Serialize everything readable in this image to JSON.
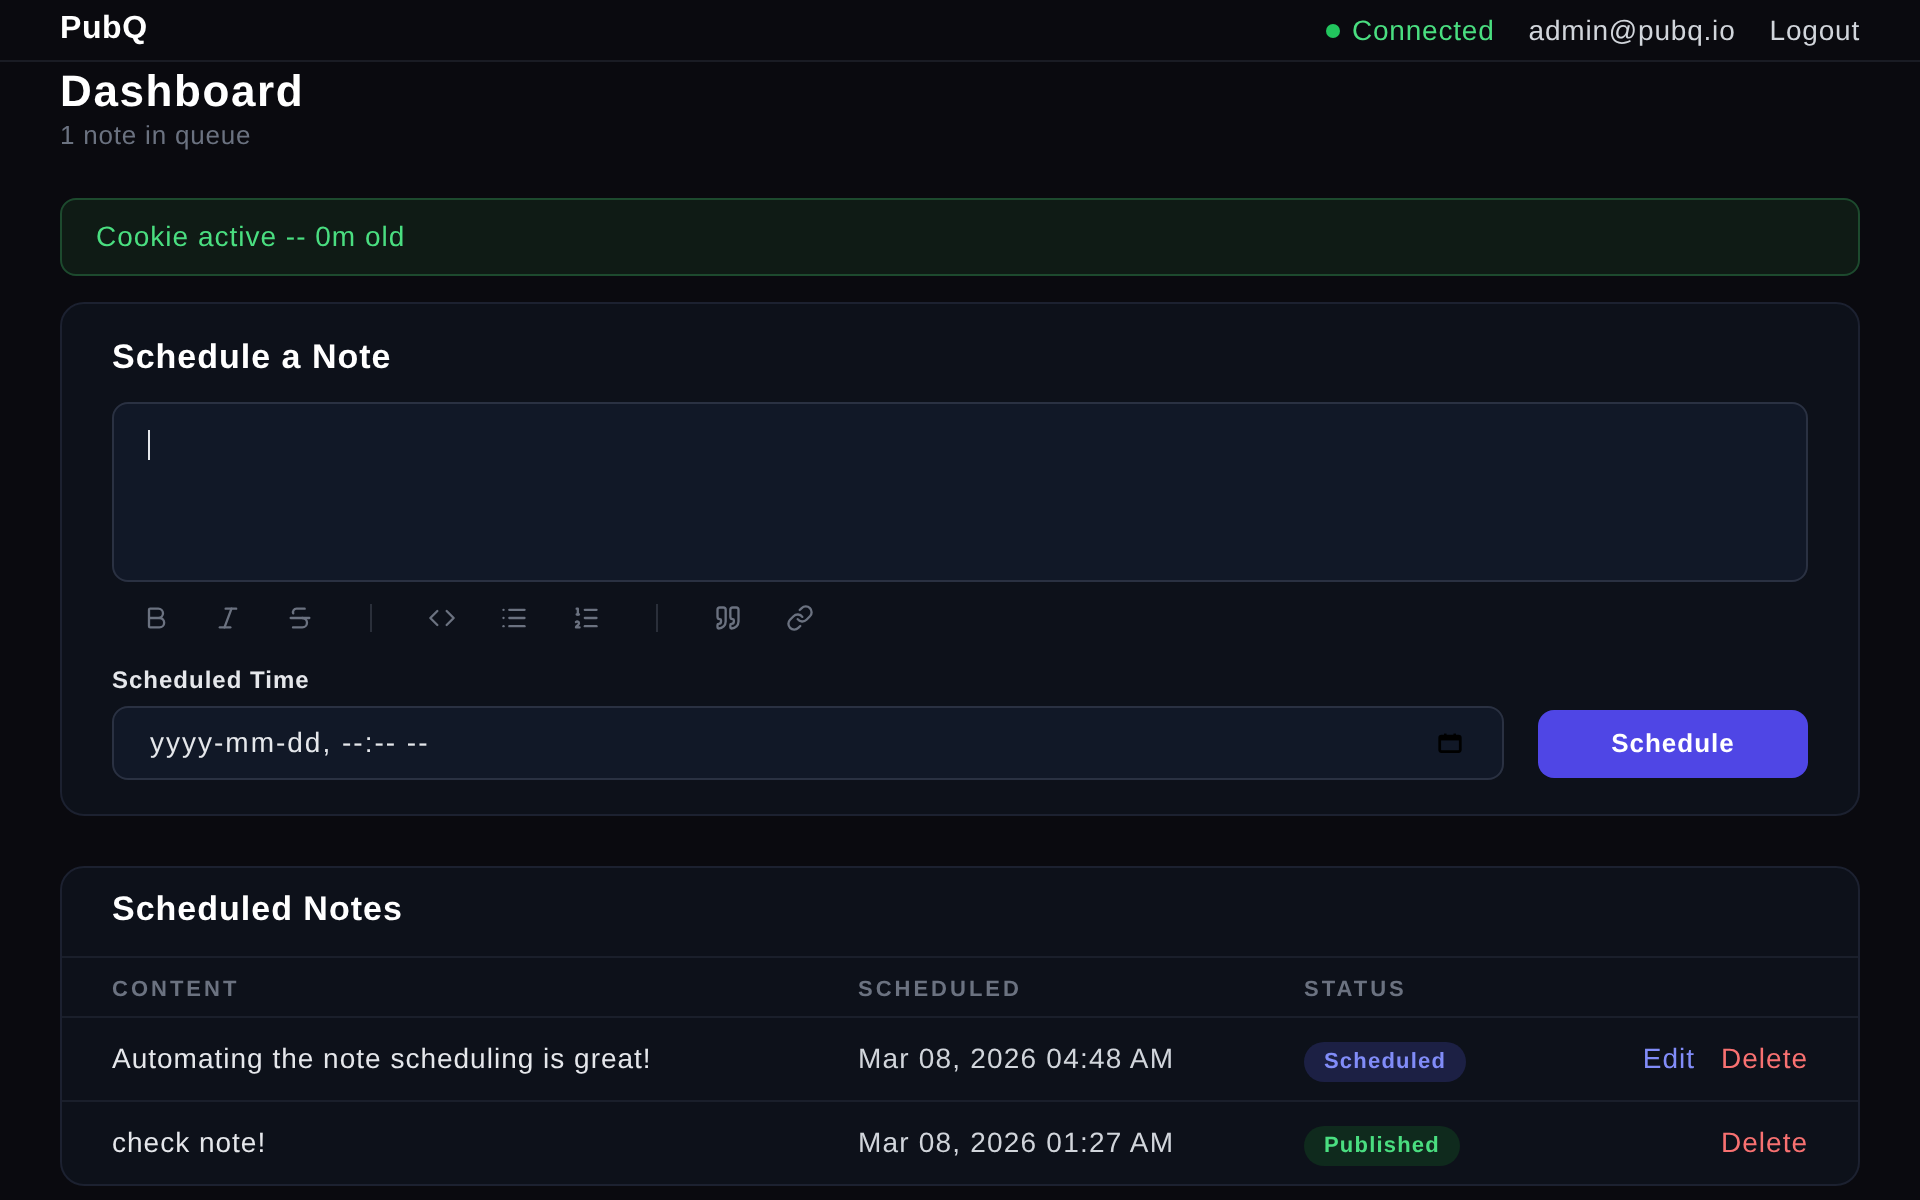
{
  "header": {
    "logo": "PubQ",
    "connection": {
      "label": "Connected",
      "on": true
    },
    "user": "admin@pubq.io",
    "logout": "Logout"
  },
  "page": {
    "title": "Dashboard",
    "subtitle": "1 note in queue"
  },
  "cookie_banner": {
    "text": "Cookie active -- 0m old"
  },
  "schedule_form": {
    "title": "Schedule a Note",
    "editor": {
      "focused": true
    },
    "time_field": {
      "label": "Scheduled Time",
      "placeholder": "yyyy-mm-dd, --:-- --"
    },
    "submit": "Schedule"
  },
  "notes_table": {
    "title": "Scheduled Notes",
    "columns": [
      "CONTENT",
      "SCHEDULED",
      "STATUS"
    ],
    "rows": [
      {
        "content": "Automating the note scheduling is great!",
        "scheduled": "Mar 08, 2026 04:48 AM",
        "status": {
          "label": "Scheduled",
          "kind": "scheduled"
        },
        "actions": [
          {
            "label": "Edit",
            "kind": "edit"
          },
          {
            "label": "Delete",
            "kind": "delete"
          }
        ]
      },
      {
        "content": "check note!",
        "scheduled": "Mar 08, 2026 01:27 AM",
        "status": {
          "label": "Published",
          "kind": "published"
        },
        "actions": [
          {
            "label": "Delete",
            "kind": "delete"
          }
        ]
      }
    ]
  }
}
